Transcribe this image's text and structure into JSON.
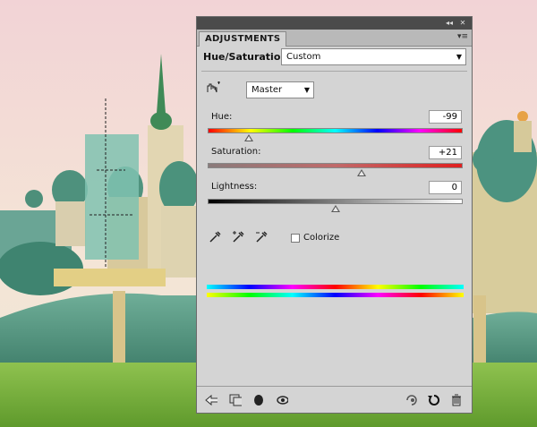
{
  "panel": {
    "tab_label": "ADJUSTMENTS",
    "adjustment_name": "Hue/Saturation",
    "preset_value": "Custom",
    "channel_value": "Master",
    "hue_label": "Hue:",
    "hue_value": "-99",
    "hue_level_fraction": 0.16,
    "saturation_label": "Saturation:",
    "saturation_value": "+21",
    "saturation_level_fraction": 0.605,
    "lightness_label": "Lightness:",
    "lightness_value": "0",
    "lightness_level_fraction": 0.5,
    "colorize_label": "Colorize",
    "colorize_checked": false
  },
  "icons": {
    "strip": [
      "collapse-icon",
      "close-icon"
    ],
    "panel_menu": "panel-menu-icon",
    "target_adjust": "targeted-adjustment-icon",
    "eyedroppers": [
      "eyedropper-icon",
      "eyedropper-plus-icon",
      "eyedropper-minus-icon"
    ],
    "footer": [
      "back-icon",
      "clip-to-layer-icon",
      "layer-mask-icon",
      "visibility-eye-icon",
      "view-previous-icon",
      "reset-icon",
      "trash-icon"
    ]
  },
  "colors": {
    "panel_bg": "#d4d4d4",
    "title_strip": "#4b4b4b",
    "sky_top": "#f3d6d8",
    "grass": "#7fb342",
    "dome_green": "#5f9e8c"
  }
}
